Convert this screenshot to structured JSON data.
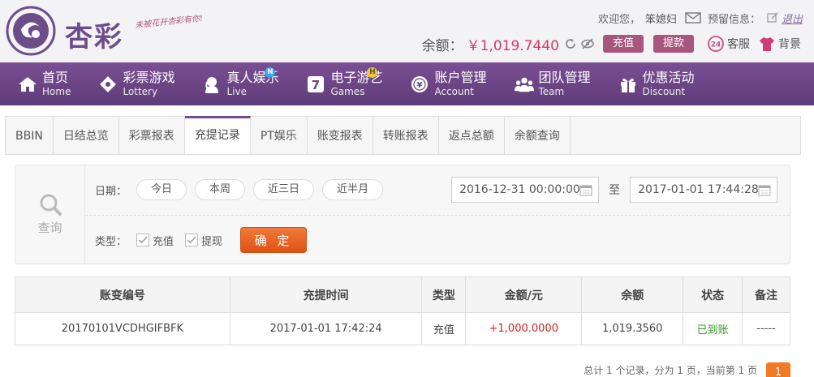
{
  "header": {
    "logo_text": "杏彩",
    "logo_slogan": "未被花开杏彩有你!",
    "welcome": "欢迎您，",
    "username": "笨媳妇",
    "notice_label": "预留信息：",
    "logout": "退出",
    "balance_label": "余额：",
    "balance_value": "￥1,019.7440",
    "deposit_button": "充值",
    "withdraw_button": "提款",
    "kefu": "客服",
    "skin": "背景"
  },
  "nav": [
    {
      "cn": "首页",
      "en": "Home",
      "icon": "home-icon"
    },
    {
      "cn": "彩票游戏",
      "en": "Lottery",
      "icon": "lottery-icon"
    },
    {
      "cn": "真人娱乐",
      "en": "Live",
      "icon": "live-icon",
      "badge": "N"
    },
    {
      "cn": "电子游艺",
      "en": "Games",
      "icon": "games-icon",
      "badge": "H"
    },
    {
      "cn": "账户管理",
      "en": "Account",
      "icon": "account-icon"
    },
    {
      "cn": "团队管理",
      "en": "Team",
      "icon": "team-icon"
    },
    {
      "cn": "优惠活动",
      "en": "Discount",
      "icon": "gift-icon"
    }
  ],
  "tabs": [
    "BBIN",
    "日结总览",
    "彩票报表",
    "充提记录",
    "PT娱乐",
    "账变报表",
    "转账报表",
    "返点总额",
    "余额查询"
  ],
  "active_tab": "充提记录",
  "query": {
    "title": "查询",
    "date_label": "日期：",
    "quick_ranges": [
      "今日",
      "本周",
      "近三日",
      "近半月"
    ],
    "start_date": "2016-12-31 00:00:00",
    "to_label": "至",
    "end_date": "2017-01-01 17:44:28",
    "type_label": "类型：",
    "types": [
      "充值",
      "提现"
    ],
    "confirm_button": "确 定"
  },
  "table": {
    "headers": [
      "账变编号",
      "充提时间",
      "类型",
      "金额/元",
      "余额",
      "状态",
      "备注"
    ],
    "rows": [
      [
        "20170101VCDHGIFBFK",
        "2017-01-01 17:42:24",
        "充值",
        "+1,000.0000",
        "1,019.3560",
        "已到账",
        "-----"
      ]
    ]
  },
  "pager": {
    "summary": "总计 1 个记录，分为 1 页，当前第 1 页",
    "current": "1"
  },
  "colors": {
    "nav_bg": "#6a4584",
    "accent_pink": "#a8567e",
    "balance": "#d33a67",
    "confirm": "#e8652a",
    "success": "#3a9a2a",
    "amount": "#d31f1f"
  }
}
